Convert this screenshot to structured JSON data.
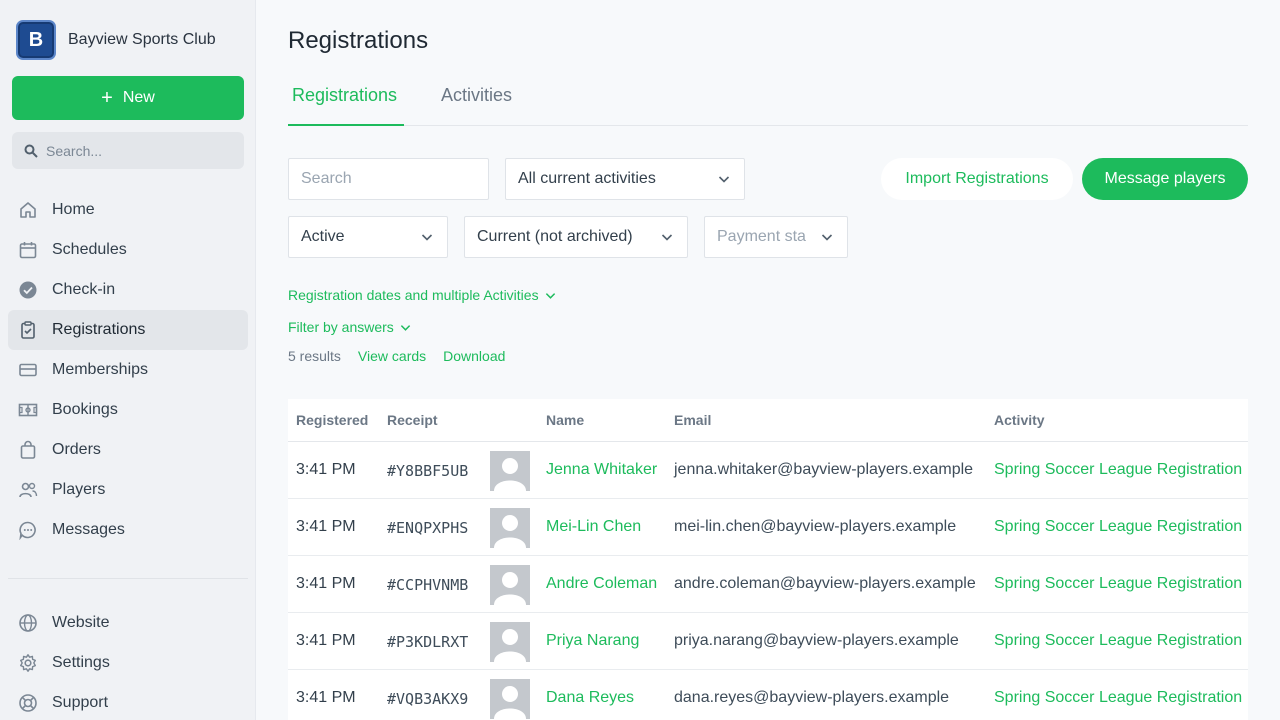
{
  "brand": {
    "initial": "B",
    "name": "Bayview Sports Club"
  },
  "sidebar": {
    "new_label": "New",
    "search_placeholder": "Search...",
    "nav": [
      {
        "label": "Home",
        "icon": "home-icon"
      },
      {
        "label": "Schedules",
        "icon": "calendar-icon"
      },
      {
        "label": "Check-in",
        "icon": "check-circle-icon"
      },
      {
        "label": "Registrations",
        "icon": "clipboard-icon",
        "active": true
      },
      {
        "label": "Memberships",
        "icon": "card-icon"
      },
      {
        "label": "Bookings",
        "icon": "field-icon"
      },
      {
        "label": "Orders",
        "icon": "bag-icon"
      },
      {
        "label": "Players",
        "icon": "users-icon"
      },
      {
        "label": "Messages",
        "icon": "chat-icon"
      }
    ],
    "bottom_nav": [
      {
        "label": "Website",
        "icon": "globe-icon"
      },
      {
        "label": "Settings",
        "icon": "gear-icon"
      },
      {
        "label": "Support",
        "icon": "lifebuoy-icon"
      }
    ]
  },
  "page": {
    "title": "Registrations",
    "tabs": [
      "Registrations",
      "Activities"
    ]
  },
  "filters": {
    "search_placeholder": "Search",
    "activities_value": "All current activities",
    "status_value": "Active",
    "archive_value": "Current (not archived)",
    "payment_placeholder": "Payment sta"
  },
  "actions": {
    "import_label": "Import Registrations",
    "message_label": "Message players"
  },
  "links": {
    "dates_filter": "Registration dates and multiple Activities",
    "answers_filter": "Filter by answers",
    "results_count": "5 results",
    "view_cards": "View cards",
    "download": "Download"
  },
  "table": {
    "headers": {
      "registered": "Registered",
      "receipt": "Receipt",
      "name": "Name",
      "email": "Email",
      "activity": "Activity"
    },
    "rows": [
      {
        "registered": "3:41 PM",
        "receipt": "#Y8BBF5UB",
        "name": "Jenna Whitaker",
        "email": "jenna.whitaker@bayview-players.example",
        "activity": "Spring Soccer League Registration"
      },
      {
        "registered": "3:41 PM",
        "receipt": "#ENQPXPHS",
        "name": "Mei-Lin Chen",
        "email": "mei-lin.chen@bayview-players.example",
        "activity": "Spring Soccer League Registration"
      },
      {
        "registered": "3:41 PM",
        "receipt": "#CCPHVNMB",
        "name": "Andre Coleman",
        "email": "andre.coleman@bayview-players.example",
        "activity": "Spring Soccer League Registration"
      },
      {
        "registered": "3:41 PM",
        "receipt": "#P3KDLRXT",
        "name": "Priya Narang",
        "email": "priya.narang@bayview-players.example",
        "activity": "Spring Soccer League Registration"
      },
      {
        "registered": "3:41 PM",
        "receipt": "#VQB3AKX9",
        "name": "Dana Reyes",
        "email": "dana.reyes@bayview-players.example",
        "activity": "Spring Soccer League Registration"
      }
    ]
  },
  "colors": {
    "accent": "#1dbb5c",
    "brand": "#1e4b91"
  }
}
